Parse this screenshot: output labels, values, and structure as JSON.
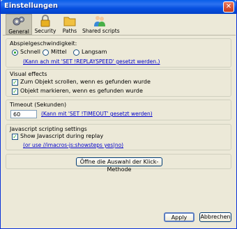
{
  "window": {
    "title": "Einstellungen",
    "close": "✕"
  },
  "toolbar": {
    "general": "General",
    "security": "Security",
    "paths": "Paths",
    "shared": "Shared scripts"
  },
  "speed": {
    "label": "Abspielgeschwindigkeit:",
    "options": [
      "Schnell",
      "Mittel",
      "Langsam"
    ],
    "selected": "Schnell",
    "link": "(Kann ach mit 'SET !REPLAYSPEED' gesetzt werden.)"
  },
  "visual": {
    "label": "Visual effects",
    "scroll": "Zum Objekt scrollen, wenn es gefunden wurde",
    "mark": "Objekt markieren, wenn es gefunden wurde"
  },
  "timeout": {
    "label": "Timeout (Sekunden)",
    "value": "60",
    "link": "(Kann mit 'SET !TIMEOUT' gesetzt werden)"
  },
  "js": {
    "label": "Javascript scripting settings",
    "show": "Show Javascript during replay",
    "link": "(or use //imacros-js:showsteps yes|no)"
  },
  "click_method_button": "Öffne die Auswahl der Klick-Methode",
  "footer": {
    "apply": "Apply",
    "cancel": "Abbrechen"
  }
}
